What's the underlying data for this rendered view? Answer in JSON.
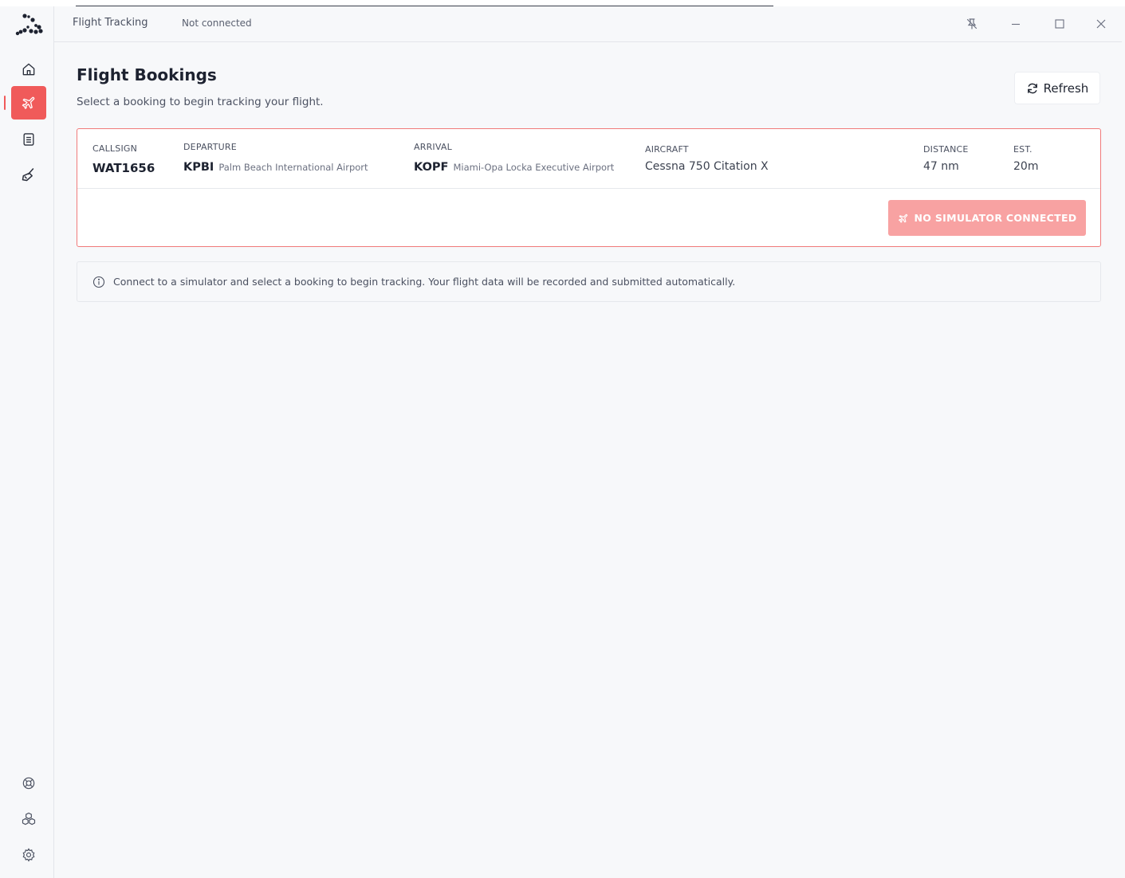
{
  "titlebar": {
    "title": "Flight Tracking",
    "status": "Not connected"
  },
  "sidebar": {
    "top_items": [
      {
        "id": "home",
        "icon": "home-icon",
        "active": false
      },
      {
        "id": "flights",
        "icon": "plane-icon",
        "active": true
      },
      {
        "id": "logbook",
        "icon": "notebook-icon",
        "active": false
      },
      {
        "id": "tools",
        "icon": "brush-icon",
        "active": false
      }
    ],
    "bottom_items": [
      {
        "id": "help",
        "icon": "lifebuoy-icon"
      },
      {
        "id": "addons",
        "icon": "boxes-icon"
      },
      {
        "id": "settings",
        "icon": "gear-icon"
      }
    ]
  },
  "page": {
    "title": "Flight Bookings",
    "subtitle": "Select a booking to begin tracking your flight.",
    "refresh_label": "Refresh"
  },
  "booking": {
    "callsign_label": "CALLSIGN",
    "callsign": "WAT1656",
    "departure_label": "DEPARTURE",
    "departure_code": "KPBI",
    "departure_name": "Palm Beach International Airport",
    "arrival_label": "ARRIVAL",
    "arrival_code": "KOPF",
    "arrival_name": "Miami-Opa Locka Executive Airport",
    "aircraft_label": "AIRCRAFT",
    "aircraft": "Cessna 750 Citation X",
    "distance_label": "DISTANCE",
    "distance": "47 nm",
    "est_label": "EST.",
    "est": "20m",
    "action_label": "NO SIMULATOR CONNECTED"
  },
  "info_message": "Connect to a simulator and select a booking to begin tracking. Your flight data will be recorded and submitted automatically.",
  "colors": {
    "accent": "#f05a5a",
    "accent_disabled": "#f8a2a2",
    "background": "#f7f8fa"
  }
}
